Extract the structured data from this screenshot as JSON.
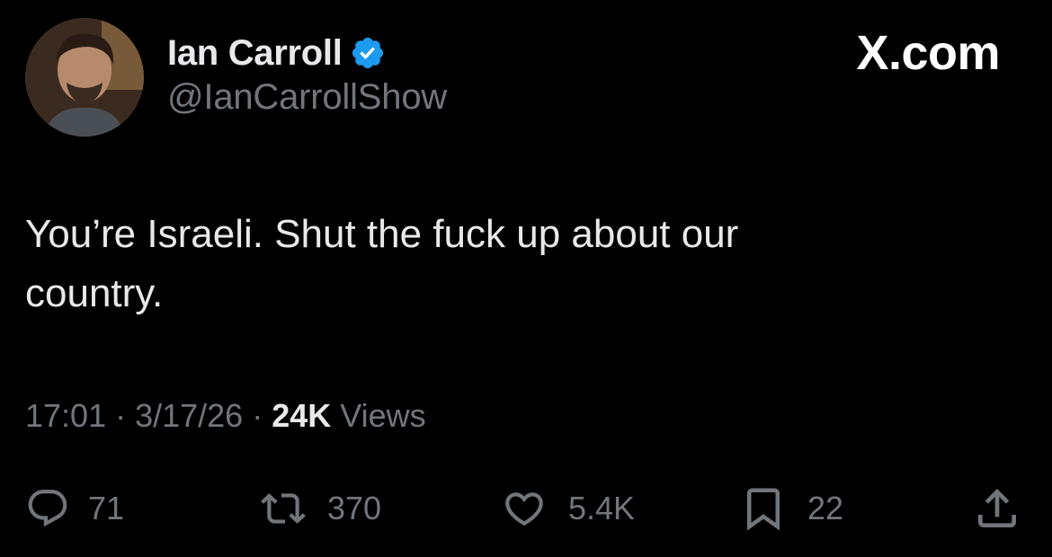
{
  "brand": "X.com",
  "author": {
    "display_name": "Ian Carroll",
    "handle": "@IanCarrollShow",
    "verified": true
  },
  "tweet": {
    "text": "You’re Israeli. Shut the fuck up about our\ncountry."
  },
  "meta": {
    "time": "17:01",
    "separator_1": "·",
    "date": "3/17/26",
    "separator_2": "·",
    "views_count": "24K",
    "views_label": "Views"
  },
  "actions": {
    "replies": "71",
    "reposts": "370",
    "likes": "5.4K",
    "bookmarks": "22"
  },
  "icons": {
    "avatar": "avatar-photo",
    "verified": "verified-badge-icon",
    "reply": "reply-icon",
    "repost": "repost-icon",
    "like": "heart-icon",
    "bookmark": "bookmark-icon",
    "share": "share-icon"
  },
  "colors": {
    "background": "#000000",
    "text_primary": "#e7e9ea",
    "text_secondary": "#71767b",
    "verified_blue": "#1d9bf0"
  }
}
